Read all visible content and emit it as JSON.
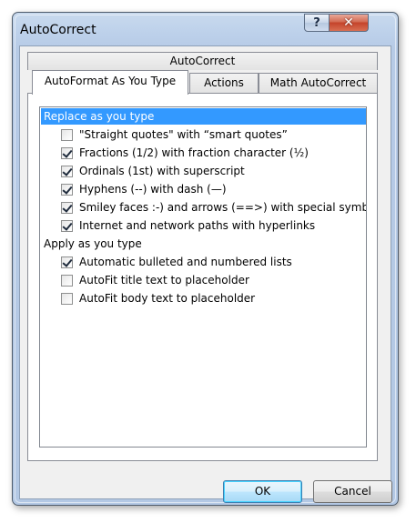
{
  "window": {
    "title": "AutoCorrect",
    "help_glyph": "?",
    "close_glyph": "✕"
  },
  "tabs": {
    "top_row": [
      "AutoCorrect"
    ],
    "bottom_row": [
      "AutoFormat As You Type",
      "Actions",
      "Math AutoCorrect"
    ],
    "selected": "AutoFormat As You Type"
  },
  "options": {
    "group1": {
      "label": "Replace as you type",
      "items": [
        {
          "label": "\"Straight quotes\" with “smart quotes”",
          "checked": false
        },
        {
          "label": "Fractions (1/2) with fraction character (½)",
          "checked": true
        },
        {
          "label": "Ordinals (1st) with superscript",
          "checked": true
        },
        {
          "label": "Hyphens (--) with dash (—)",
          "checked": true
        },
        {
          "label": "Smiley faces :-) and arrows (==>) with special symbols",
          "checked": true
        },
        {
          "label": "Internet and network paths with hyperlinks",
          "checked": true
        }
      ]
    },
    "group2": {
      "label": "Apply as you type",
      "items": [
        {
          "label": "Automatic bulleted and numbered lists",
          "checked": true
        },
        {
          "label": "AutoFit title text to placeholder",
          "checked": false
        },
        {
          "label": "AutoFit body text to placeholder",
          "checked": false
        }
      ]
    }
  },
  "buttons": {
    "ok": "OK",
    "cancel": "Cancel"
  },
  "colors": {
    "selection_highlight": "#3399ff",
    "title_bar": "#bcd0ea",
    "close_button": "#c4432a"
  }
}
